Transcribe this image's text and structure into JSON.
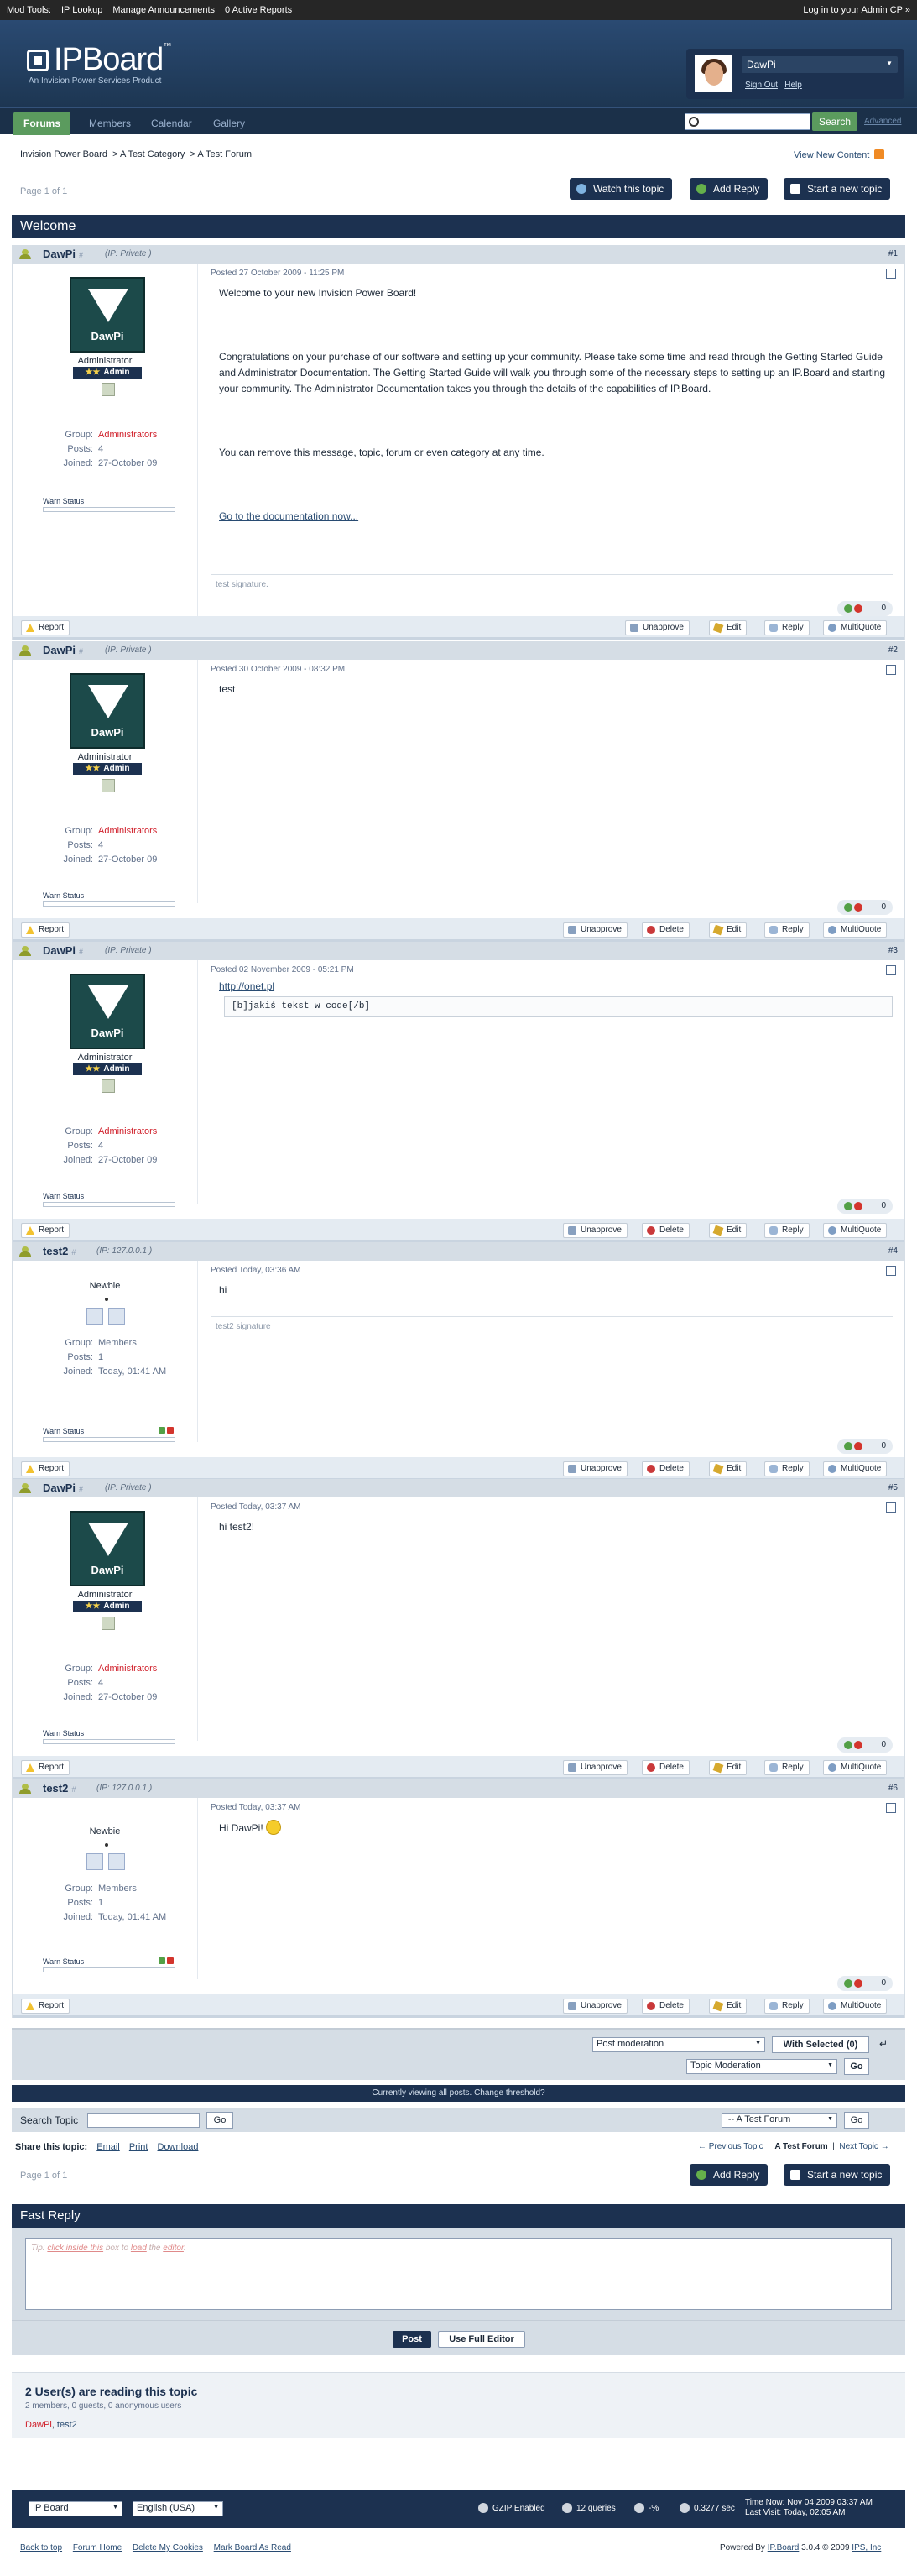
{
  "modbar": {
    "label": "Mod Tools:",
    "ip_lookup": "IP Lookup",
    "announcements": "Manage Announcements",
    "reports": "0 Active Reports",
    "admin_cp": "Log in to your Admin CP »"
  },
  "brand": {
    "logo_text": "IPBoard",
    "tm": "™",
    "tagline": "An Invision Power Services Product"
  },
  "user": {
    "name": "DawPi",
    "sign_out": "Sign Out",
    "help": "Help"
  },
  "nav": {
    "tabs": [
      "Forums",
      "Members",
      "Calendar",
      "Gallery"
    ],
    "search_button": "Search",
    "advanced": "Advanced"
  },
  "breadcrumb": {
    "items": [
      "Invision Power Board",
      "A Test Category",
      "A Test Forum"
    ]
  },
  "view_new_content": "View New Content",
  "pagination": "Page 1 of 1",
  "buttons": {
    "watch": "Watch this topic",
    "add_reply": "Add Reply",
    "new_topic": "Start a new topic"
  },
  "topic_title": "Welcome",
  "posts": [
    {
      "author": "DawPi",
      "ip": "(IP: Private )",
      "num": "#1",
      "date": "Posted 27 October 2009 - 11:25 PM",
      "avatar_name": "DawPi",
      "role": "Administrator",
      "badge": "Admin",
      "group_label": "Group:",
      "group": "Administrators",
      "posts_label": "Posts:",
      "posts": "4",
      "joined_label": "Joined:",
      "joined": "27-October 09",
      "warn": "Warn Status",
      "text": [
        "Welcome to your new Invision Power Board!",
        "Congratulations on your purchase of our software and setting up your community. Please take some time and read through the Getting Started Guide and Administrator Documentation. The Getting Started Guide will walk you through some of the necessary steps to setting up an IP.Board and starting your community. The Administrator Documentation takes you through the details of the capabilities of IP.Board.",
        "You can remove this message, topic, forum or even category at any time.",
        "Go to the documentation now..."
      ],
      "signature": "test signature.",
      "rep": "0",
      "actions": [
        "Report",
        "Unapprove",
        "Edit",
        "Reply",
        "MultiQuote"
      ]
    },
    {
      "author": "DawPi",
      "ip": "(IP: Private )",
      "num": "#2",
      "date": "Posted 30 October 2009 - 08:32 PM",
      "avatar_name": "DawPi",
      "role": "Administrator",
      "badge": "Admin",
      "group_label": "Group:",
      "group": "Administrators",
      "posts_label": "Posts:",
      "posts": "4",
      "joined_label": "Joined:",
      "joined": "27-October 09",
      "warn": "Warn Status",
      "text": [
        "test"
      ],
      "rep": "0",
      "actions": [
        "Report",
        "Unapprove",
        "Delete",
        "Edit",
        "Reply",
        "MultiQuote"
      ]
    },
    {
      "author": "DawPi",
      "ip": "(IP: Private )",
      "num": "#3",
      "date": "Posted 02 November 2009 - 05:21 PM",
      "avatar_name": "DawPi",
      "role": "Administrator",
      "badge": "Admin",
      "group_label": "Group:",
      "group": "Administrators",
      "posts_label": "Posts:",
      "posts": "4",
      "joined_label": "Joined:",
      "joined": "27-October 09",
      "warn": "Warn Status",
      "link": "http://onet.pl",
      "code": "[b]jakiś tekst w code[/b]",
      "rep": "0",
      "actions": [
        "Report",
        "Unapprove",
        "Delete",
        "Edit",
        "Reply",
        "MultiQuote"
      ]
    },
    {
      "author": "test2",
      "ip": "(IP: 127.0.0.1 )",
      "num": "#4",
      "date": "Posted Today, 03:36 AM",
      "role": "Newbie",
      "group_label": "Group:",
      "group": "Members",
      "posts_label": "Posts:",
      "posts": "1",
      "joined_label": "Joined:",
      "joined": "Today, 01:41 AM",
      "warn": "Warn Status",
      "text": [
        "hi"
      ],
      "signature": "test2 signature",
      "rep": "0",
      "actions": [
        "Report",
        "Unapprove",
        "Delete",
        "Edit",
        "Reply",
        "MultiQuote"
      ]
    },
    {
      "author": "DawPi",
      "ip": "(IP: Private )",
      "num": "#5",
      "date": "Posted Today, 03:37 AM",
      "avatar_name": "DawPi",
      "role": "Administrator",
      "badge": "Admin",
      "group_label": "Group:",
      "group": "Administrators",
      "posts_label": "Posts:",
      "posts": "4",
      "joined_label": "Joined:",
      "joined": "27-October 09",
      "warn": "Warn Status",
      "text": [
        "hi test2!"
      ],
      "rep": "0",
      "actions": [
        "Report",
        "Unapprove",
        "Delete",
        "Edit",
        "Reply",
        "MultiQuote"
      ]
    },
    {
      "author": "test2",
      "ip": "(IP: 127.0.0.1 )",
      "num": "#6",
      "date": "Posted Today, 03:37 AM",
      "role": "Newbie",
      "group_label": "Group:",
      "group": "Members",
      "posts_label": "Posts:",
      "posts": "1",
      "joined_label": "Joined:",
      "joined": "Today, 01:41 AM",
      "warn": "Warn Status",
      "text": [
        "Hi DawPi!"
      ],
      "rep": "0",
      "actions": [
        "Report",
        "Unapprove",
        "Delete",
        "Edit",
        "Reply",
        "MultiQuote"
      ]
    }
  ],
  "moderation": {
    "post_mod": "Post moderation",
    "with_selected": "With Selected (0)",
    "topic_mod": "Topic Moderation",
    "go": "Go"
  },
  "threshold": "Currently viewing all posts. Change threshold?",
  "search_topic": {
    "label": "Search Topic",
    "go": "Go",
    "forum_jump": "|-- A Test Forum",
    "go2": "Go"
  },
  "share": {
    "label": "Share this topic:",
    "email": "Email",
    "print": "Print",
    "download": "Download"
  },
  "topic_nav": {
    "prev": "← Previous Topic",
    "current": "A Test Forum",
    "next": "Next Topic →"
  },
  "fast_reply": {
    "title": "Fast Reply",
    "tip_prefix": "Tip: ",
    "tip_link1": "click inside this",
    "tip_mid1": " box to ",
    "tip_link2": "load",
    "tip_mid2": " the ",
    "tip_link3": "editor",
    "tip_end": ".",
    "post": "Post",
    "full_editor": "Use Full Editor"
  },
  "readers": {
    "title": "2 User(s) are reading this topic",
    "sub": "2 members, 0 guests, 0 anonymous users",
    "user1": "DawPi",
    "sep": ", ",
    "user2": "test2"
  },
  "footer": {
    "skin": "IP Board",
    "lang": "English (USA)",
    "gzip": "GZIP Enabled",
    "queries": "12 queries",
    "mem": "-%",
    "time_sec": "0.3277 sec",
    "time_now": "Time Now: Nov 04 2009 03:37 AM",
    "last_visit": "Last Visit: Today, 02:05 AM"
  },
  "bottom_links": [
    "Back to top",
    "Forum Home",
    "Delete My Cookies",
    "Mark Board As Read"
  ],
  "copyright": {
    "prefix": "Powered By ",
    "ipb": "IP.Board",
    "mid": " 3.0.4 © 2009  ",
    "ips": "IPS, Inc"
  }
}
